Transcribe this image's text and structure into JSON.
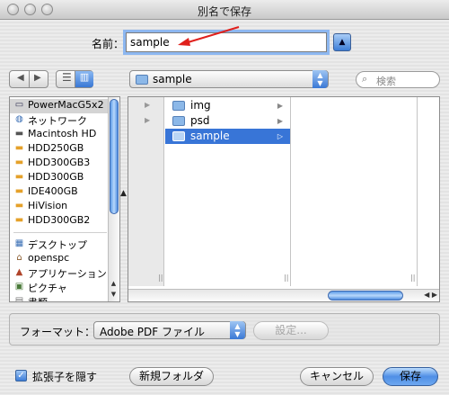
{
  "window": {
    "title": "別名で保存"
  },
  "save": {
    "name_label": "名前：",
    "filename": "sample",
    "expand_symbol": "▲"
  },
  "nav": {
    "back_forward": "◀ ▶",
    "view_list": "☰",
    "view_column": "▥",
    "location": "sample",
    "search_placeholder": "検索"
  },
  "sidebar": {
    "items": [
      {
        "label": "PowerMacG5x2",
        "icon": "computer-icon",
        "selected": true
      },
      {
        "label": "ネットワーク",
        "icon": "network-icon"
      },
      {
        "label": "Macintosh HD",
        "icon": "hard-disk-icon"
      },
      {
        "label": "HDD250GB",
        "icon": "hard-disk-icon"
      },
      {
        "label": "HDD300GB3",
        "icon": "hard-disk-icon"
      },
      {
        "label": "HDD300GB",
        "icon": "hard-disk-icon"
      },
      {
        "label": "IDE400GB",
        "icon": "hard-disk-icon"
      },
      {
        "label": "HiVision",
        "icon": "hard-disk-icon"
      },
      {
        "label": "HDD300GB2",
        "icon": "hard-disk-icon"
      },
      {
        "label": "デスクトップ",
        "icon": "desktop-icon"
      },
      {
        "label": "openspc",
        "icon": "home-icon"
      },
      {
        "label": "アプリケーション",
        "icon": "applications-icon"
      },
      {
        "label": "ピクチャ",
        "icon": "pictures-icon"
      },
      {
        "label": "書類",
        "icon": "documents-icon"
      }
    ]
  },
  "browser": {
    "folders": [
      {
        "label": "img",
        "selected": false
      },
      {
        "label": "psd",
        "selected": false
      },
      {
        "label": "sample",
        "selected": true
      }
    ]
  },
  "format": {
    "label": "フォーマット：",
    "selected": "Adobe PDF ファイル",
    "settings_button": "設定..."
  },
  "footer": {
    "hide_extension_label": "拡張子を隠す",
    "hide_extension_checked": true,
    "new_folder_button": "新規フォルダ",
    "cancel_button": "キャンセル",
    "save_button": "保存"
  },
  "colors": {
    "accent": "#3875d7",
    "annotation_arrow": "#e0201c"
  }
}
